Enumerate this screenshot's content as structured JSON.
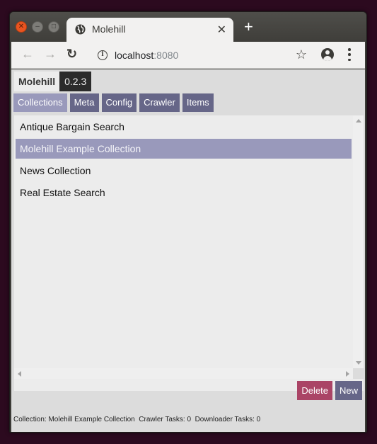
{
  "browser": {
    "tab_title": "Molehill",
    "url_host": "localhost",
    "url_port": ":8080"
  },
  "app": {
    "name": "Molehill",
    "version": "0.2.3"
  },
  "nav_tabs": [
    {
      "label": "Collections",
      "active": true
    },
    {
      "label": "Meta",
      "active": false
    },
    {
      "label": "Config",
      "active": false
    },
    {
      "label": "Crawler",
      "active": false
    },
    {
      "label": "Items",
      "active": false
    }
  ],
  "collections": [
    {
      "label": "Antique Bargain Search",
      "selected": false
    },
    {
      "label": "Molehill Example Collection",
      "selected": true
    },
    {
      "label": "News Collection",
      "selected": false
    },
    {
      "label": "Real Estate Search",
      "selected": false
    }
  ],
  "actions": {
    "delete_label": "Delete",
    "new_label": "New"
  },
  "status_bar": {
    "text": "Collection: Molehill Example Collection  Crawler Tasks: 0  Downloader Tasks: 0"
  },
  "colors": {
    "tab_inactive": "#666688",
    "tab_active": "#9999bb",
    "delete": "#aa4466",
    "selected_row": "#9999bb"
  }
}
